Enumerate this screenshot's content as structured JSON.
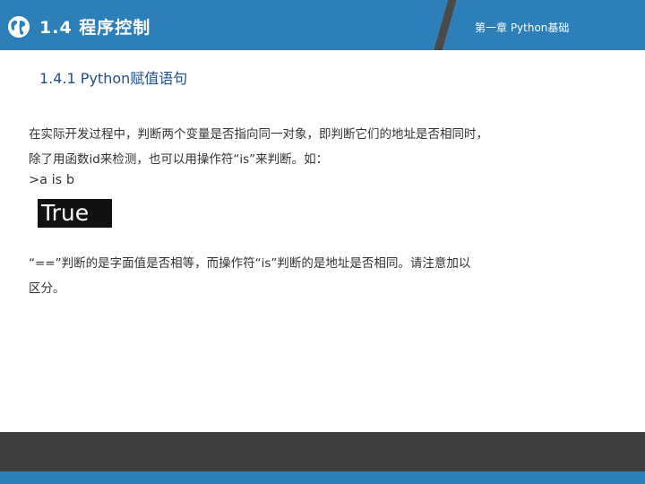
{
  "colors": {
    "header_blue": "#2c7fb8",
    "header_blue_dark": "#1e6ea8",
    "header_gray": "#4a4a4a",
    "subheading": "#1f4e8c",
    "footer_dark": "#3e3e3e",
    "footer_blue": "#2c7fb8"
  },
  "header": {
    "section_title": "1.4 程序控制",
    "chapter_label": "第一章 Python基础",
    "icon": "globe-icon"
  },
  "content": {
    "subheading": "1.4.1 Python赋值语句",
    "paragraph1_line1": "在实际开发过程中，判断两个变量是否指向同一对象，即判断它们的地址是否相同时，",
    "paragraph1_line2": "除了用函数id来检测，也可以用操作符“is”来判断。如：",
    "code": ">a is b",
    "output": "True",
    "paragraph2_line1": "“==”判断的是字面值是否相等，而操作符“is”判断的是地址是否相同。请注意加以",
    "paragraph2_line2": "区分。"
  }
}
